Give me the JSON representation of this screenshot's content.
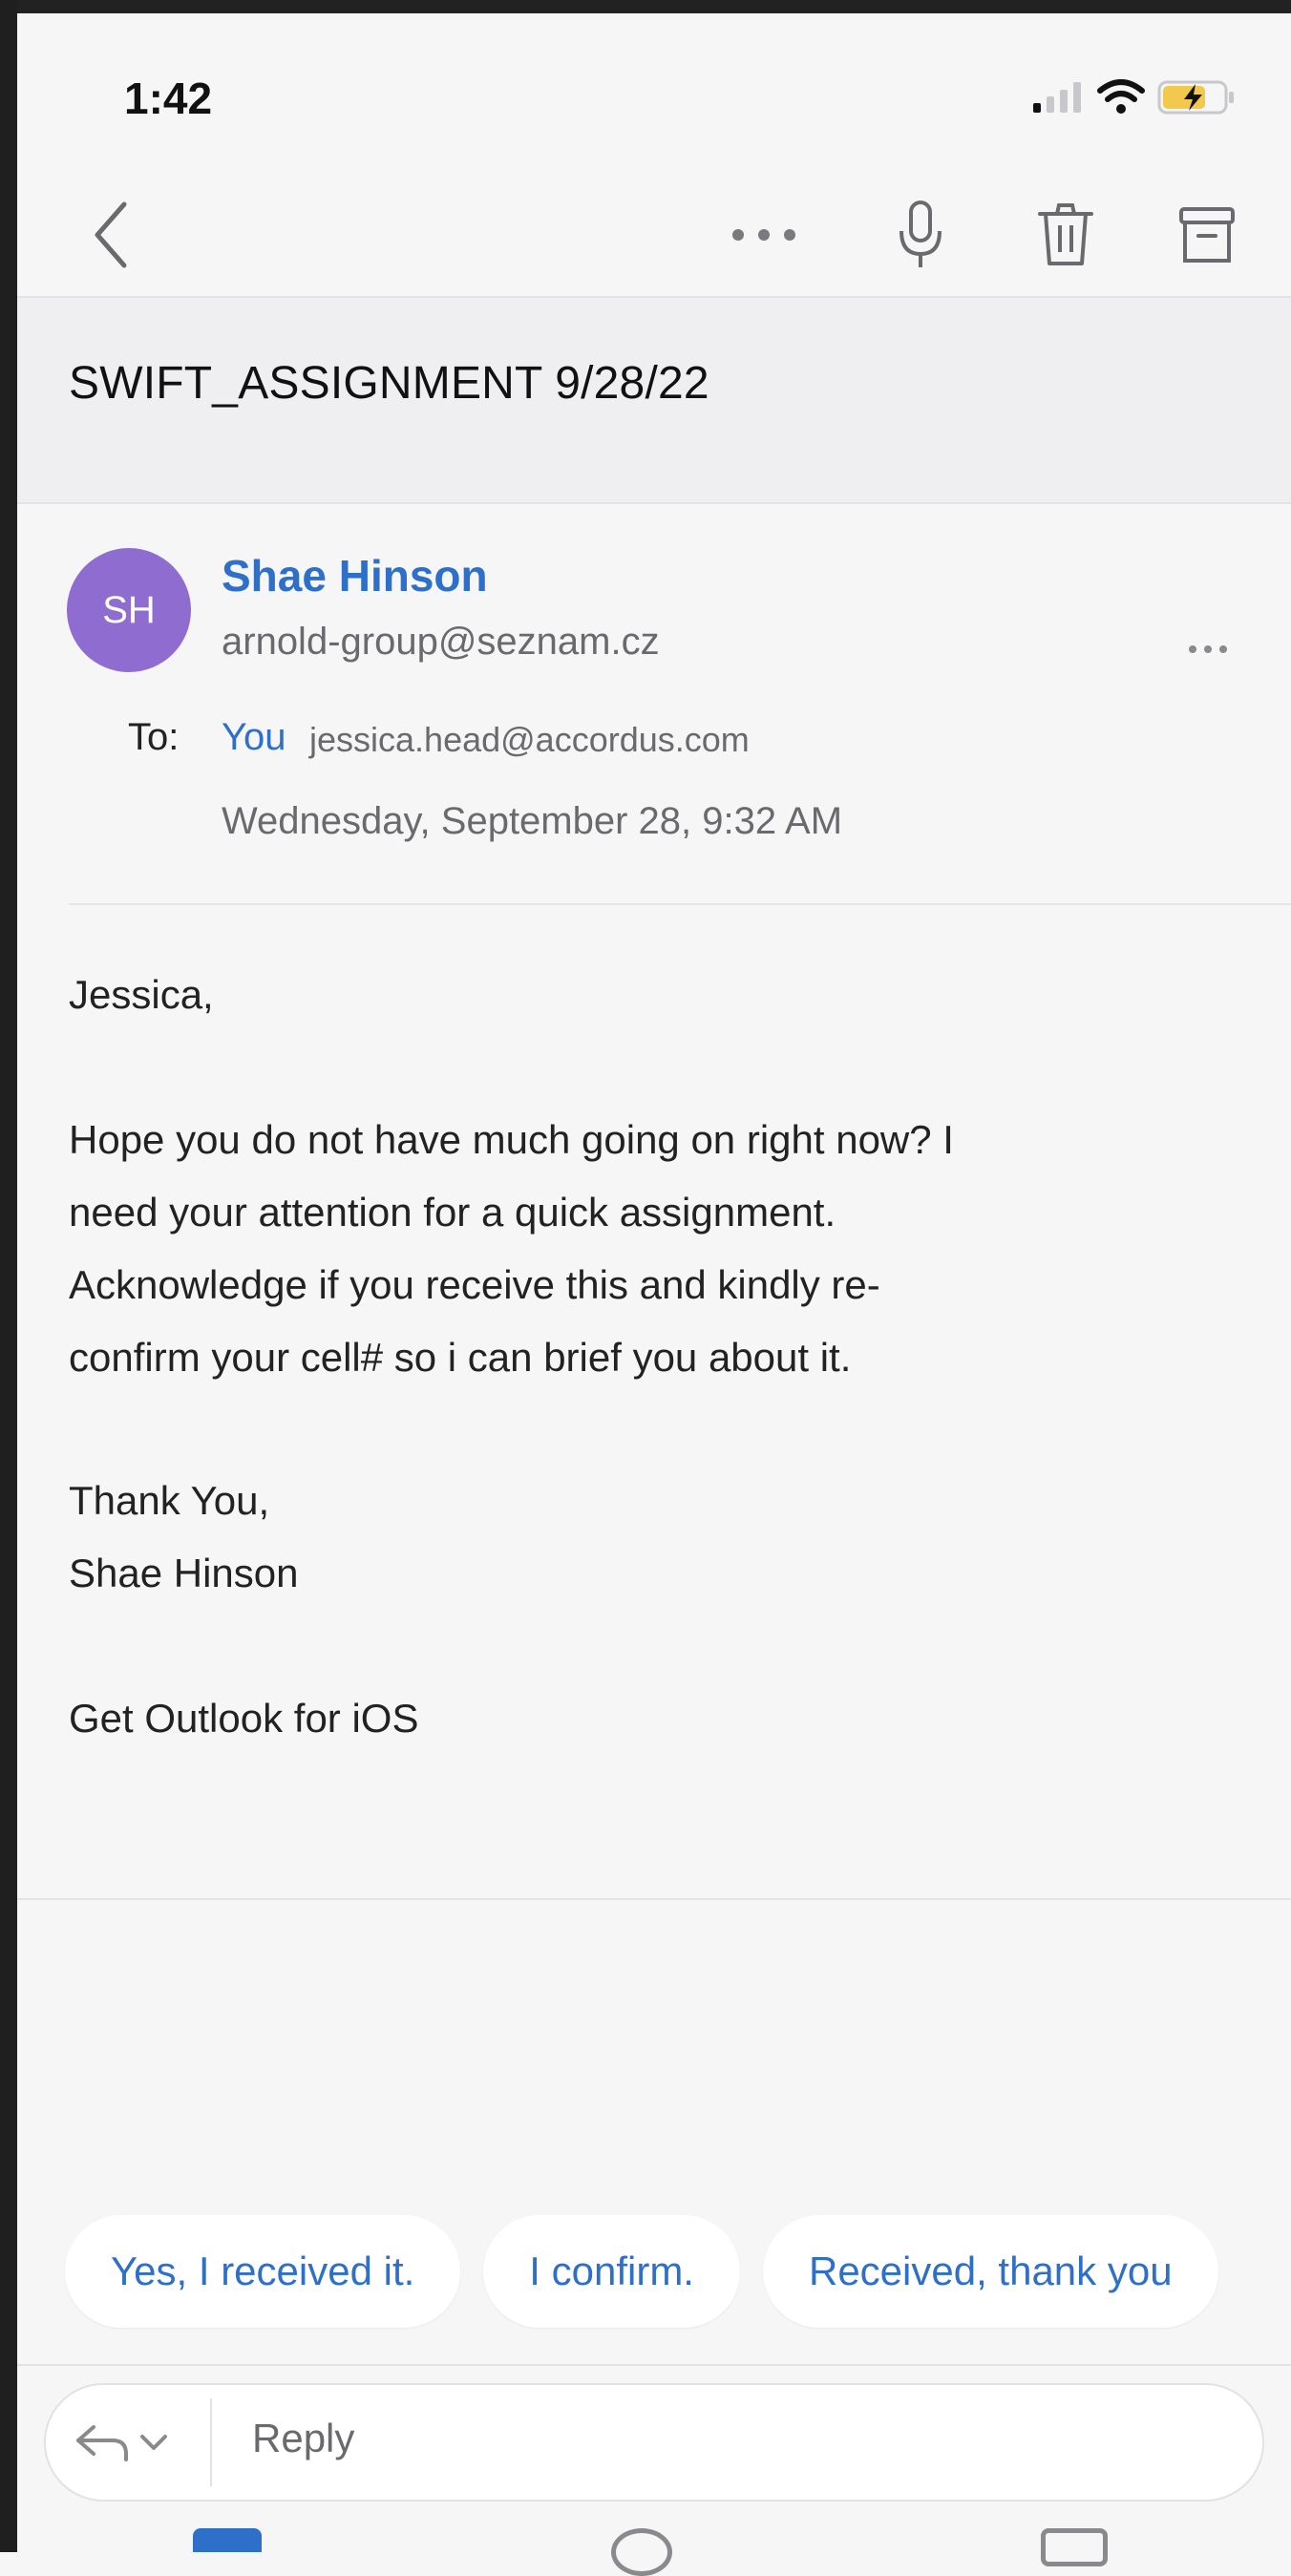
{
  "status_bar": {
    "time": "1:42"
  },
  "toolbar": {
    "back_icon": "chevron-left-icon",
    "more_icon": "ellipsis-icon",
    "mic_icon": "microphone-icon",
    "delete_icon": "trash-icon",
    "archive_icon": "archive-icon"
  },
  "subject": "SWIFT_ASSIGNMENT 9/28/22",
  "message": {
    "avatar_initials": "SH",
    "sender_name": "Shae Hinson",
    "sender_email": "arnold-group@seznam.cz",
    "to_label": "To:",
    "to_you": "You",
    "to_email": "jessica.head@accordus.com",
    "date": "Wednesday, September 28, 9:32 AM",
    "body": {
      "greeting": "Jessica,",
      "paragraph": [
        "Hope you do not have much going on right now? I",
        "need your attention for a quick assignment.",
        "Acknowledge if you receive this and kindly re-",
        "confirm your cell# so i can brief you about it."
      ],
      "closing": "Thank You,",
      "signature": "Shae Hinson",
      "footer": "Get Outlook for iOS"
    }
  },
  "suggestions": [
    "Yes, I received it.",
    "I confirm.",
    "Received, thank you"
  ],
  "reply": {
    "placeholder": "Reply"
  },
  "colors": {
    "accent": "#2e6fc9",
    "avatar": "#8f6ccf",
    "battery": "#f2c94c"
  }
}
